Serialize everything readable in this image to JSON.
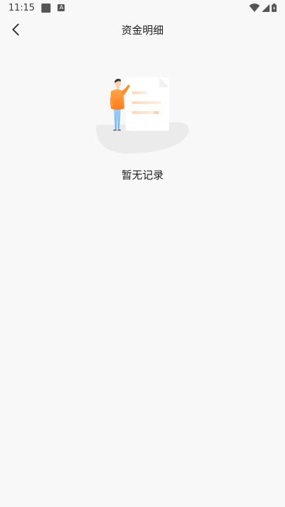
{
  "status_bar": {
    "time": "11:15",
    "a_label": "A"
  },
  "header": {
    "title": "资金明细"
  },
  "empty_state": {
    "message": "暂无记录"
  },
  "colors": {
    "background": "#f8f8f8",
    "accent_orange": "#ff8a1f",
    "figure_pants": "#8ec6f7"
  }
}
